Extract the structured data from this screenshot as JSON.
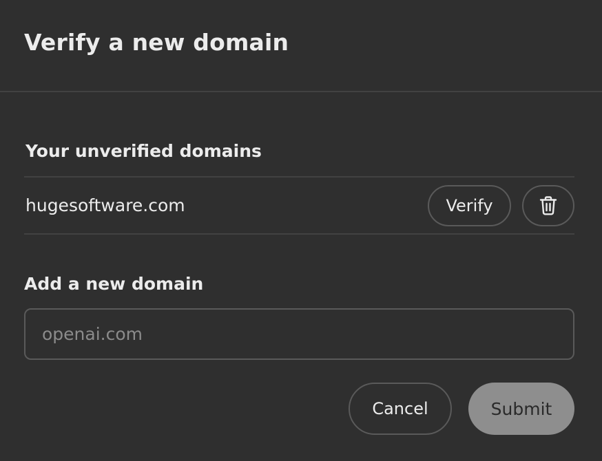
{
  "dialog": {
    "title": "Verify a new domain"
  },
  "unverified": {
    "heading": "Your unverified domains",
    "domains": [
      {
        "name": "hugesoftware.com",
        "verify_label": "Verify",
        "delete_icon": "trash-icon"
      }
    ]
  },
  "add_domain": {
    "label": "Add a new domain",
    "value": "",
    "placeholder": "openai.com"
  },
  "footer": {
    "cancel_label": "Cancel",
    "submit_label": "Submit"
  },
  "colors": {
    "background": "#2f2f2f",
    "divider": "#424242",
    "border": "#5a5a5a",
    "submit_disabled_bg": "#8e8e8e",
    "text": "#ececec",
    "placeholder": "#8b8b8b"
  }
}
